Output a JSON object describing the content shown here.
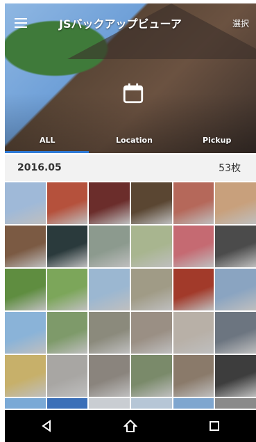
{
  "header": {
    "title": "JSバックアップビューア",
    "select_label": "選択",
    "menu_icon": "menu-icon",
    "calendar_icon": "calendar-icon"
  },
  "tabs": [
    {
      "label": "ALL",
      "active": true
    },
    {
      "label": "Location",
      "active": false
    },
    {
      "label": "Pickup",
      "active": false
    }
  ],
  "section": {
    "date": "2016.05",
    "count": "53枚"
  },
  "photos": [
    "#9fb9d8",
    "#b5513c",
    "#6b2d2b",
    "#5a4632",
    "#b5685a",
    "#c8a07c",
    "#7b5a43",
    "#2a3a3c",
    "#8c9a8e",
    "#a8b58f",
    "#c56a72",
    "#4b4b4b",
    "#5f8d40",
    "#7ca65a",
    "#9bb7d1",
    "#a09b86",
    "#a23a2a",
    "#8aa4c1",
    "#8ab3d8",
    "#7e9a6a",
    "#8b8a7c",
    "#9a8f84",
    "#b8b0a7",
    "#6c7580",
    "#c7b06a",
    "#a8a6a3",
    "#8a847d",
    "#7a8a6a",
    "#8a7a6a",
    "#3d3d3d",
    "#7aa9d6",
    "#3b6fb8",
    "#c9cdd2",
    "#b6c6d6",
    "#7fa6cf",
    "#8a8a8a"
  ],
  "colors": {
    "accent": "#2f7ad6",
    "nav_bg": "#000000"
  },
  "nav": {
    "back_icon": "back-icon",
    "home_icon": "home-icon",
    "recents_icon": "recents-icon"
  }
}
